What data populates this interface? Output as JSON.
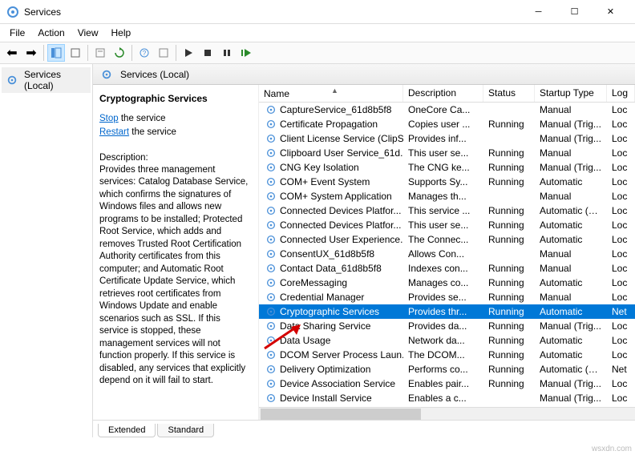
{
  "window": {
    "title": "Services"
  },
  "menu": {
    "file": "File",
    "action": "Action",
    "view": "View",
    "help": "Help"
  },
  "tree": {
    "root": "Services (Local)"
  },
  "header": {
    "title": "Services (Local)"
  },
  "descpane": {
    "title": "Cryptographic Services",
    "stop_word": "Stop",
    "stop_rest": " the service",
    "restart_word": "Restart",
    "restart_rest": " the service",
    "desc_label": "Description:",
    "desc_text": "Provides three management services: Catalog Database Service, which confirms the signatures of Windows files and allows new programs to be installed; Protected Root Service, which adds and removes Trusted Root Certification Authority certificates from this computer; and Automatic Root Certificate Update Service, which retrieves root certificates from Windows Update and enable scenarios such as SSL. If this service is stopped, these management services will not function properly. If this service is disabled, any services that explicitly depend on it will fail to start."
  },
  "columns": {
    "c0": "Name",
    "c1": "Description",
    "c2": "Status",
    "c3": "Startup Type",
    "c4": "Log"
  },
  "services": [
    {
      "name": "CaptureService_61d8b5f8",
      "desc": "OneCore Ca...",
      "status": "",
      "startup": "Manual",
      "log": "Loc"
    },
    {
      "name": "Certificate Propagation",
      "desc": "Copies user ...",
      "status": "Running",
      "startup": "Manual (Trig...",
      "log": "Loc"
    },
    {
      "name": "Client License Service (ClipS...",
      "desc": "Provides inf...",
      "status": "",
      "startup": "Manual (Trig...",
      "log": "Loc"
    },
    {
      "name": "Clipboard User Service_61d...",
      "desc": "This user se...",
      "status": "Running",
      "startup": "Manual",
      "log": "Loc"
    },
    {
      "name": "CNG Key Isolation",
      "desc": "The CNG ke...",
      "status": "Running",
      "startup": "Manual (Trig...",
      "log": "Loc"
    },
    {
      "name": "COM+ Event System",
      "desc": "Supports Sy...",
      "status": "Running",
      "startup": "Automatic",
      "log": "Loc"
    },
    {
      "name": "COM+ System Application",
      "desc": "Manages th...",
      "status": "",
      "startup": "Manual",
      "log": "Loc"
    },
    {
      "name": "Connected Devices Platfor...",
      "desc": "This service ...",
      "status": "Running",
      "startup": "Automatic (D...",
      "log": "Loc"
    },
    {
      "name": "Connected Devices Platfor...",
      "desc": "This user se...",
      "status": "Running",
      "startup": "Automatic",
      "log": "Loc"
    },
    {
      "name": "Connected User Experience...",
      "desc": "The Connec...",
      "status": "Running",
      "startup": "Automatic",
      "log": "Loc"
    },
    {
      "name": "ConsentUX_61d8b5f8",
      "desc": "Allows Con...",
      "status": "",
      "startup": "Manual",
      "log": "Loc"
    },
    {
      "name": "Contact Data_61d8b5f8",
      "desc": "Indexes con...",
      "status": "Running",
      "startup": "Manual",
      "log": "Loc"
    },
    {
      "name": "CoreMessaging",
      "desc": "Manages co...",
      "status": "Running",
      "startup": "Automatic",
      "log": "Loc"
    },
    {
      "name": "Credential Manager",
      "desc": "Provides se...",
      "status": "Running",
      "startup": "Manual",
      "log": "Loc"
    },
    {
      "name": "Cryptographic Services",
      "desc": "Provides thr...",
      "status": "Running",
      "startup": "Automatic",
      "log": "Net",
      "selected": true
    },
    {
      "name": "Data Sharing Service",
      "desc": "Provides da...",
      "status": "Running",
      "startup": "Manual (Trig...",
      "log": "Loc"
    },
    {
      "name": "Data Usage",
      "desc": "Network da...",
      "status": "Running",
      "startup": "Automatic",
      "log": "Loc"
    },
    {
      "name": "DCOM Server Process Laun...",
      "desc": "The DCOM...",
      "status": "Running",
      "startup": "Automatic",
      "log": "Loc"
    },
    {
      "name": "Delivery Optimization",
      "desc": "Performs co...",
      "status": "Running",
      "startup": "Automatic (D...",
      "log": "Net"
    },
    {
      "name": "Device Association Service",
      "desc": "Enables pair...",
      "status": "Running",
      "startup": "Manual (Trig...",
      "log": "Loc"
    },
    {
      "name": "Device Install Service",
      "desc": "Enables a c...",
      "status": "",
      "startup": "Manual (Trig...",
      "log": "Loc"
    }
  ],
  "tabs": {
    "extended": "Extended",
    "standard": "Standard"
  },
  "watermark": "wsxdn.com"
}
